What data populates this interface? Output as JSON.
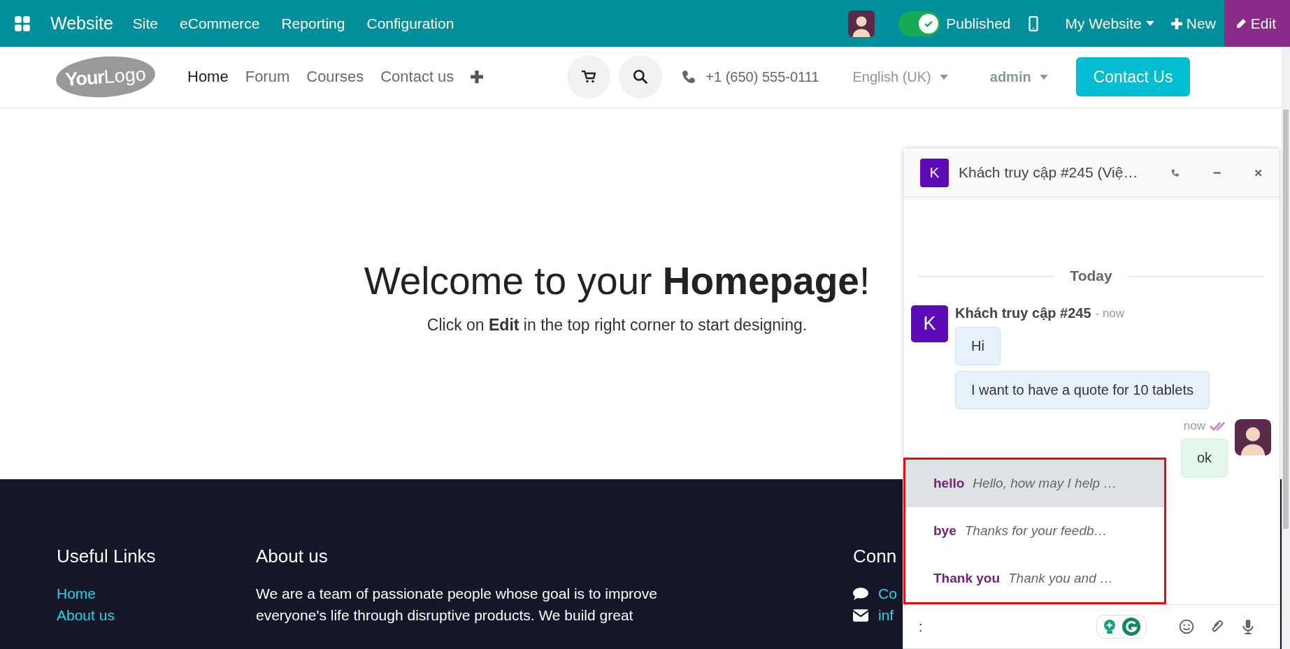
{
  "topbar": {
    "app_name": "Website",
    "menu": [
      "Site",
      "eCommerce",
      "Reporting",
      "Configuration"
    ],
    "published": {
      "label": "Published",
      "on": true
    },
    "website_menu": "My Website",
    "new_button": "New",
    "edit_button": "Edit"
  },
  "navbar": {
    "logo": {
      "bold": "Your",
      "light": "Logo"
    },
    "links": [
      {
        "label": "Home",
        "selected": true
      },
      {
        "label": "Forum",
        "selected": false
      },
      {
        "label": "Courses",
        "selected": false
      },
      {
        "label": "Contact us",
        "selected": false
      }
    ],
    "phone": "+1 (650) 555-0111",
    "language": "English (UK)",
    "user": "admin",
    "contact_button": "Contact Us"
  },
  "hero": {
    "title": "Welcome to your **Homepage**!",
    "subtitle": "Click on **Edit** in the top right corner to start designing."
  },
  "footer": {
    "columns": [
      {
        "kind": "links",
        "title": "Useful Links",
        "links": [
          "Home",
          "About us"
        ]
      },
      {
        "kind": "text",
        "title": "About us",
        "text": "We are a team of passionate people whose goal is to improve everyone's life through disruptive products. We build great"
      },
      {
        "kind": "contact",
        "title": "Conn",
        "items": [
          {
            "kind": "chat",
            "text": "Co"
          },
          {
            "kind": "email",
            "text": "inf"
          }
        ]
      }
    ]
  },
  "chat": {
    "title": "Khách truy cập #245 (Việ…",
    "avatar_letter": "K",
    "divider": "Today",
    "messages": [
      {
        "kind": "incoming",
        "author": "Khách truy cập #245",
        "time": "- now",
        "avatar_letter": "K",
        "bubbles": [
          "Hi",
          "I want to have a quote for 10 tablets"
        ]
      },
      {
        "kind": "outgoing",
        "time": "now",
        "seen": true,
        "bubbles": [
          "ok"
        ]
      }
    ],
    "suggestions_highlighted": true,
    "suggestions": [
      {
        "name": "hello",
        "preview": "Hello, how may I help …",
        "selected": true
      },
      {
        "name": "bye",
        "preview": "Thanks for your feedb…",
        "selected": false
      },
      {
        "name": "Thank you",
        "preview": "Thank you and …",
        "selected": false
      }
    ],
    "composer": {
      "value": ":"
    }
  }
}
